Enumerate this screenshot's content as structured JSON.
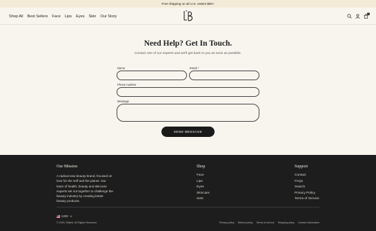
{
  "announcement": "Free shipping on all U.S. orders $50+",
  "nav": {
    "items": [
      "Shop All",
      "Best Sellers",
      "Face",
      "Lips",
      "Eyes",
      "Skin",
      "Our Story"
    ]
  },
  "cart": {
    "count": "0"
  },
  "contact": {
    "title": "Need Help? Get In Touch.",
    "subtitle": "Contact one of our experts and we'll get back to you as soon as possible.",
    "name_label": "Name",
    "email_label": "Email *",
    "phone_label": "Phone number",
    "message_label": "Message",
    "send_label": "SEND MESSAGE"
  },
  "footer": {
    "mission_heading": "Our Mission",
    "mission_text": "A radical new beauty brand, focused on love for the self and the planet. Our team of health, beauty and skincare experts set out together to challenge the beauty industry by creating better beauty products.",
    "shop_heading": "Shop",
    "shop_items": [
      "Face",
      "Lips",
      "Eyes",
      "Skincare",
      "Sets"
    ],
    "support_heading": "Support",
    "support_items": [
      "Contact",
      "FAQs",
      "Search",
      "Privacy Policy",
      "Terms of Service"
    ],
    "currency": "USD",
    "copyright": "© 2025, Skilled. All Rights Reserved.",
    "policies": [
      "Privacy policy",
      "Refund policy",
      "Terms of service",
      "Shipping policy",
      "Contact information"
    ]
  },
  "colors": {
    "background": "#f8f5ef",
    "announcement_bg": "#f3ead8",
    "footer_bg": "#1d1d1d",
    "button_bg": "#1a1a1a"
  },
  "icons": [
    "search-icon",
    "account-icon",
    "cart-icon",
    "flag-icon",
    "chevron-down-icon"
  ]
}
